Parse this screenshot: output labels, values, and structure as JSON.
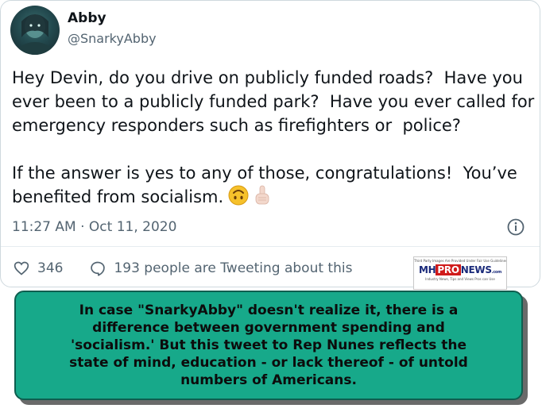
{
  "tweet": {
    "author": {
      "display_name": "Abby",
      "handle": "@SnarkyAbby",
      "avatar_icon": "user-avatar"
    },
    "text": "Hey Devin, do you drive on publicly funded roads?  Have you ever been to a publicly funded park?  Have you ever called for emergency responders such as firefighters or  police?\n\nIf the answer is yes to any of those, congratulations!  You’ve benefited from socialism.",
    "emojis": [
      "upside-down-face-emoji",
      "index-pointing-up-emoji"
    ],
    "timestamp": "11:27 AM · Oct 11, 2020",
    "info_icon": "info-icon",
    "likes": "346",
    "conversation": "193 people are Tweeting about this"
  },
  "watermark": {
    "top_line": "Third Party Images Are Provided Under Fair Use Guidelines.",
    "logo_mh": "MH",
    "logo_pro": "PRO",
    "logo_news": "NEWS",
    "logo_com": ".com",
    "bottom_line": "Industry News, Tips and Views Pros can Use"
  },
  "annotation": {
    "text": "In case \"SnarkyAbby\" doesn't realize it, there is a\ndifference between government spending and\n'socialism.'  But this tweet to Rep Nunes reflects the\nstate of mind, education - or lack thereof - of untold\nnumbers of Americans.",
    "background_color": "#17a98a",
    "border_color": "#0e5e4f"
  }
}
